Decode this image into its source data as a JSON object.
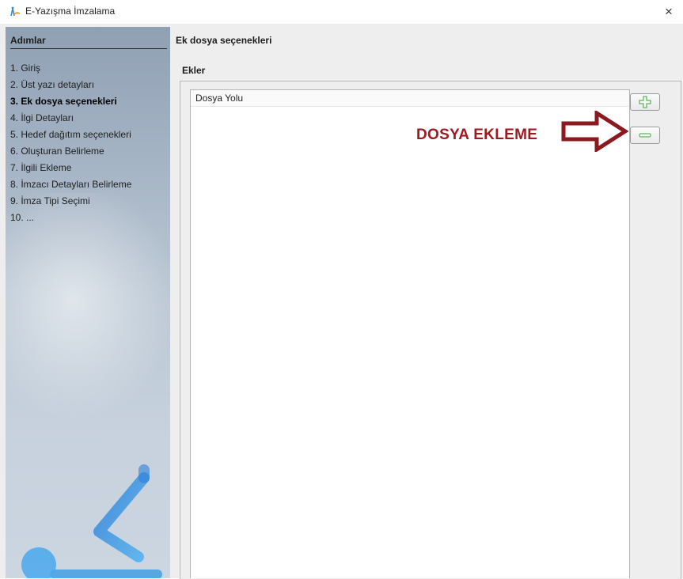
{
  "window": {
    "title": "E-Yazışma İmzalama",
    "icon": "app-figure-icon",
    "close_glyph": "×"
  },
  "sidebar": {
    "header": "Adımlar",
    "steps": [
      {
        "label": "1. Giriş",
        "active": false
      },
      {
        "label": "2. Üst yazı detayları",
        "active": false
      },
      {
        "label": "3. Ek dosya seçenekleri",
        "active": true
      },
      {
        "label": "4. İlgi Detayları",
        "active": false
      },
      {
        "label": "5. Hedef dağıtım seçenekleri",
        "active": false
      },
      {
        "label": "6. Oluşturan Belirleme",
        "active": false
      },
      {
        "label": "7. İlgili Ekleme",
        "active": false
      },
      {
        "label": "8. İmzacı Detayları Belirleme",
        "active": false
      },
      {
        "label": "9. İmza Tipi Seçimi",
        "active": false
      },
      {
        "label": "10. ...",
        "active": false
      }
    ],
    "logo": "e-sigma-logo"
  },
  "main": {
    "title": "Ek dosya seçenekleri",
    "section_label": "Ekler",
    "table": {
      "columns": [
        "Dosya Yolu"
      ],
      "rows": []
    },
    "buttons": {
      "add": {
        "icon": "plus-icon",
        "color": "#5cb85c"
      },
      "remove": {
        "icon": "minus-icon",
        "color": "#5cb85c"
      }
    }
  },
  "annotation": {
    "text": "DOSYA EKLEME",
    "color": "#9e1a22",
    "arrow_icon": "right-arrow-icon"
  }
}
